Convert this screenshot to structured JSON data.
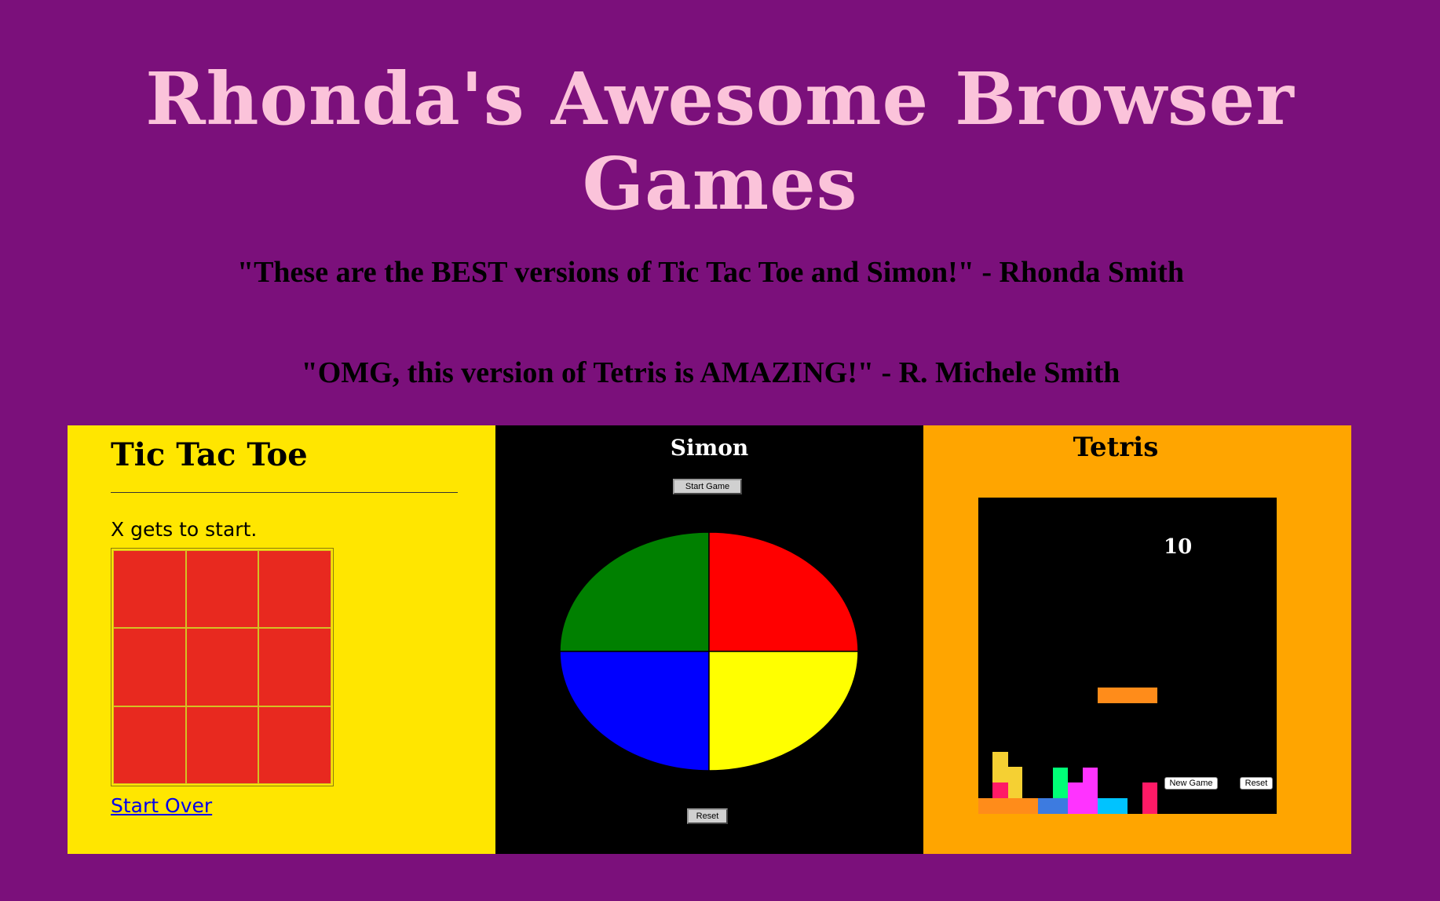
{
  "page": {
    "title": "Rhonda's Awesome Browser Games",
    "quotes": [
      "\"These are the BEST versions of Tic Tac Toe and Simon!\" - Rhonda Smith",
      "\"OMG, this version of Tetris is AMAZING!\" - R. Michele Smith"
    ]
  },
  "tic_tac_toe": {
    "title": "Tic Tac Toe",
    "status": "X gets to start.",
    "cells": [
      "",
      "",
      "",
      "",
      "",
      "",
      "",
      "",
      ""
    ],
    "start_over": "Start Over",
    "cell_color": "#e8291f"
  },
  "simon": {
    "title": "Simon",
    "start_button": "Start Game",
    "reset_button": "Reset",
    "colors": {
      "top_left": "#008000",
      "top_right": "#ff0000",
      "bottom_left": "#0000ff",
      "bottom_right": "#ffff00"
    }
  },
  "tetris": {
    "title": "Tetris",
    "score": "10",
    "new_game_button": "New Game",
    "reset_button": "Reset"
  },
  "colors": {
    "background": "#7b107b",
    "title": "#fbc3da",
    "ttt_panel": "#ffe600",
    "simon_panel": "#000000",
    "tetris_panel": "#ffa500"
  }
}
